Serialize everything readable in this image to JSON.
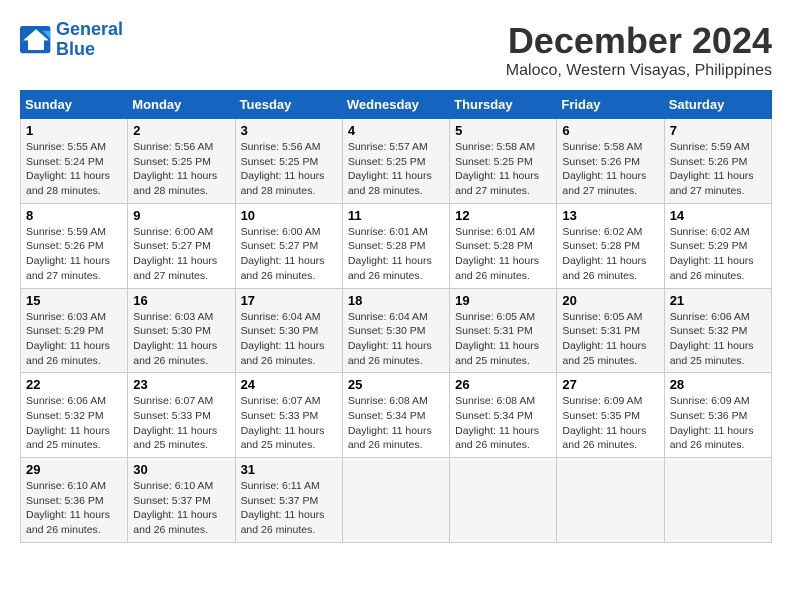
{
  "logo": {
    "line1": "General",
    "line2": "Blue"
  },
  "title": "December 2024",
  "subtitle": "Maloco, Western Visayas, Philippines",
  "headers": [
    "Sunday",
    "Monday",
    "Tuesday",
    "Wednesday",
    "Thursday",
    "Friday",
    "Saturday"
  ],
  "weeks": [
    [
      {
        "day": "1",
        "info": "Sunrise: 5:55 AM\nSunset: 5:24 PM\nDaylight: 11 hours\nand 28 minutes."
      },
      {
        "day": "2",
        "info": "Sunrise: 5:56 AM\nSunset: 5:25 PM\nDaylight: 11 hours\nand 28 minutes."
      },
      {
        "day": "3",
        "info": "Sunrise: 5:56 AM\nSunset: 5:25 PM\nDaylight: 11 hours\nand 28 minutes."
      },
      {
        "day": "4",
        "info": "Sunrise: 5:57 AM\nSunset: 5:25 PM\nDaylight: 11 hours\nand 28 minutes."
      },
      {
        "day": "5",
        "info": "Sunrise: 5:58 AM\nSunset: 5:25 PM\nDaylight: 11 hours\nand 27 minutes."
      },
      {
        "day": "6",
        "info": "Sunrise: 5:58 AM\nSunset: 5:26 PM\nDaylight: 11 hours\nand 27 minutes."
      },
      {
        "day": "7",
        "info": "Sunrise: 5:59 AM\nSunset: 5:26 PM\nDaylight: 11 hours\nand 27 minutes."
      }
    ],
    [
      {
        "day": "8",
        "info": "Sunrise: 5:59 AM\nSunset: 5:26 PM\nDaylight: 11 hours\nand 27 minutes."
      },
      {
        "day": "9",
        "info": "Sunrise: 6:00 AM\nSunset: 5:27 PM\nDaylight: 11 hours\nand 27 minutes."
      },
      {
        "day": "10",
        "info": "Sunrise: 6:00 AM\nSunset: 5:27 PM\nDaylight: 11 hours\nand 26 minutes."
      },
      {
        "day": "11",
        "info": "Sunrise: 6:01 AM\nSunset: 5:28 PM\nDaylight: 11 hours\nand 26 minutes."
      },
      {
        "day": "12",
        "info": "Sunrise: 6:01 AM\nSunset: 5:28 PM\nDaylight: 11 hours\nand 26 minutes."
      },
      {
        "day": "13",
        "info": "Sunrise: 6:02 AM\nSunset: 5:28 PM\nDaylight: 11 hours\nand 26 minutes."
      },
      {
        "day": "14",
        "info": "Sunrise: 6:02 AM\nSunset: 5:29 PM\nDaylight: 11 hours\nand 26 minutes."
      }
    ],
    [
      {
        "day": "15",
        "info": "Sunrise: 6:03 AM\nSunset: 5:29 PM\nDaylight: 11 hours\nand 26 minutes."
      },
      {
        "day": "16",
        "info": "Sunrise: 6:03 AM\nSunset: 5:30 PM\nDaylight: 11 hours\nand 26 minutes."
      },
      {
        "day": "17",
        "info": "Sunrise: 6:04 AM\nSunset: 5:30 PM\nDaylight: 11 hours\nand 26 minutes."
      },
      {
        "day": "18",
        "info": "Sunrise: 6:04 AM\nSunset: 5:30 PM\nDaylight: 11 hours\nand 26 minutes."
      },
      {
        "day": "19",
        "info": "Sunrise: 6:05 AM\nSunset: 5:31 PM\nDaylight: 11 hours\nand 25 minutes."
      },
      {
        "day": "20",
        "info": "Sunrise: 6:05 AM\nSunset: 5:31 PM\nDaylight: 11 hours\nand 25 minutes."
      },
      {
        "day": "21",
        "info": "Sunrise: 6:06 AM\nSunset: 5:32 PM\nDaylight: 11 hours\nand 25 minutes."
      }
    ],
    [
      {
        "day": "22",
        "info": "Sunrise: 6:06 AM\nSunset: 5:32 PM\nDaylight: 11 hours\nand 25 minutes."
      },
      {
        "day": "23",
        "info": "Sunrise: 6:07 AM\nSunset: 5:33 PM\nDaylight: 11 hours\nand 25 minutes."
      },
      {
        "day": "24",
        "info": "Sunrise: 6:07 AM\nSunset: 5:33 PM\nDaylight: 11 hours\nand 25 minutes."
      },
      {
        "day": "25",
        "info": "Sunrise: 6:08 AM\nSunset: 5:34 PM\nDaylight: 11 hours\nand 26 minutes."
      },
      {
        "day": "26",
        "info": "Sunrise: 6:08 AM\nSunset: 5:34 PM\nDaylight: 11 hours\nand 26 minutes."
      },
      {
        "day": "27",
        "info": "Sunrise: 6:09 AM\nSunset: 5:35 PM\nDaylight: 11 hours\nand 26 minutes."
      },
      {
        "day": "28",
        "info": "Sunrise: 6:09 AM\nSunset: 5:36 PM\nDaylight: 11 hours\nand 26 minutes."
      }
    ],
    [
      {
        "day": "29",
        "info": "Sunrise: 6:10 AM\nSunset: 5:36 PM\nDaylight: 11 hours\nand 26 minutes."
      },
      {
        "day": "30",
        "info": "Sunrise: 6:10 AM\nSunset: 5:37 PM\nDaylight: 11 hours\nand 26 minutes."
      },
      {
        "day": "31",
        "info": "Sunrise: 6:11 AM\nSunset: 5:37 PM\nDaylight: 11 hours\nand 26 minutes."
      },
      {
        "day": "",
        "info": ""
      },
      {
        "day": "",
        "info": ""
      },
      {
        "day": "",
        "info": ""
      },
      {
        "day": "",
        "info": ""
      }
    ]
  ]
}
